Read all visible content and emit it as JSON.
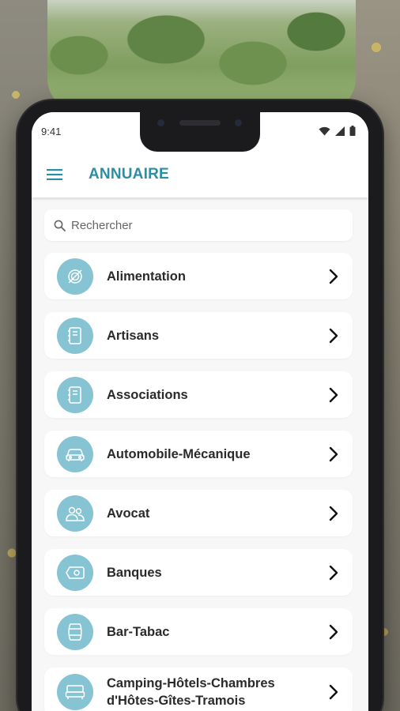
{
  "status_bar": {
    "time": "9:41"
  },
  "app_bar": {
    "title": "ANNUAIRE",
    "menu_icon": "hamburger-menu-icon"
  },
  "search": {
    "placeholder": "Rechercher",
    "value": "",
    "icon": "search-icon"
  },
  "colors": {
    "accent": "#2b8ea5",
    "icon_circle": "#86c3d3",
    "list_background": "#f7f7f7",
    "card_background": "#ffffff"
  },
  "categories": [
    {
      "label": "Alimentation",
      "icon": "food-plate-icon"
    },
    {
      "label": "Artisans",
      "icon": "notebook-icon"
    },
    {
      "label": "Associations",
      "icon": "notebook-icon"
    },
    {
      "label": "Automobile-Mécanique",
      "icon": "car-icon"
    },
    {
      "label": "Avocat",
      "icon": "people-icon"
    },
    {
      "label": "Banques",
      "icon": "money-bill-icon"
    },
    {
      "label": "Bar-Tabac",
      "icon": "barrel-icon"
    },
    {
      "label": "Camping-Hôtels-Chambres d'Hôtes-Gîtes-Tramois",
      "icon": "bed-icon"
    }
  ]
}
